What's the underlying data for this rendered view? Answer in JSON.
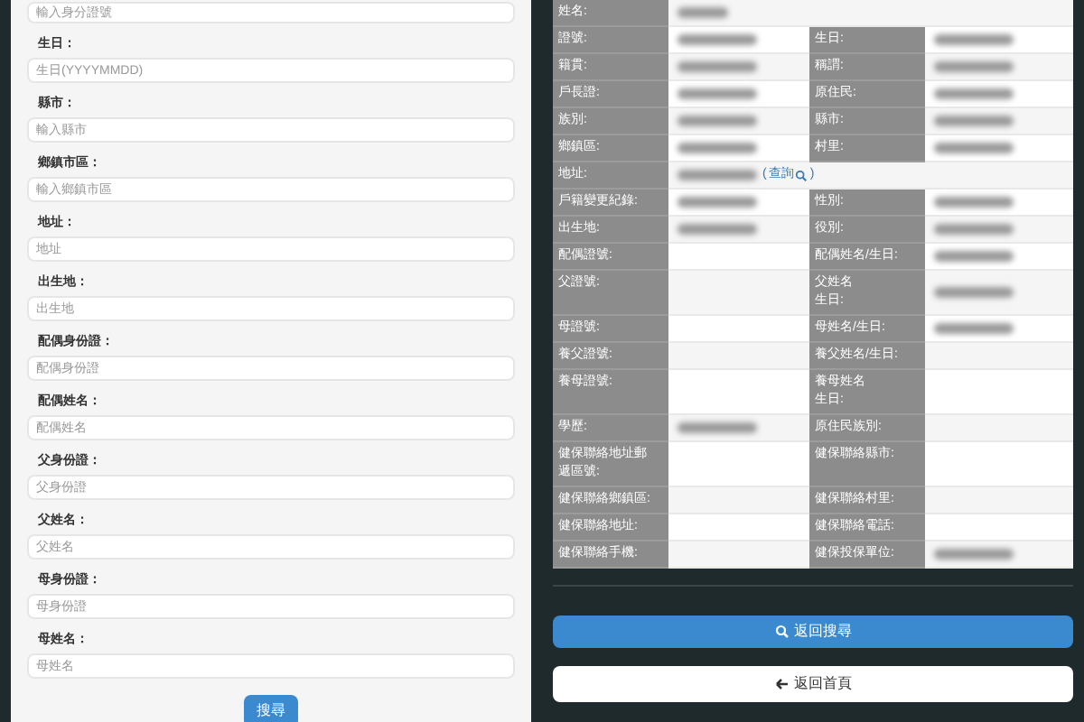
{
  "search_form": {
    "top_field": {
      "placeholder": "輸入身分證號"
    },
    "fields": [
      {
        "label": "生日：",
        "placeholder": "生日(YYYYMMDD)"
      },
      {
        "label": "縣市：",
        "placeholder": "輸入縣市"
      },
      {
        "label": "鄉鎮市區：",
        "placeholder": "輸入鄉鎮市區"
      },
      {
        "label": "地址：",
        "placeholder": "地址"
      },
      {
        "label": "出生地：",
        "placeholder": "出生地"
      },
      {
        "label": "配偶身份證：",
        "placeholder": "配偶身份證"
      },
      {
        "label": "配偶姓名：",
        "placeholder": "配偶姓名"
      },
      {
        "label": "父身份證：",
        "placeholder": "父身份證"
      },
      {
        "label": "父姓名：",
        "placeholder": "父姓名"
      },
      {
        "label": "母身份證：",
        "placeholder": "母身份證"
      },
      {
        "label": "母姓名：",
        "placeholder": "母姓名"
      }
    ],
    "submit": "搜尋"
  },
  "record": {
    "rows": [
      {
        "cells": [
          {
            "label": [
              "姓名:"
            ],
            "blurred": true
          }
        ]
      },
      {
        "cells": [
          {
            "label": [
              "證號:"
            ],
            "blurred": true
          },
          {
            "label": [
              "生日:"
            ],
            "blurred": true
          }
        ]
      },
      {
        "cells": [
          {
            "label": [
              "籍貫:"
            ],
            "blurred": true
          },
          {
            "label": [
              "稱謂:"
            ],
            "blurred": true
          }
        ]
      },
      {
        "cells": [
          {
            "label": [
              "戶長證:"
            ],
            "blurred": true
          },
          {
            "label": [
              "原住民:"
            ],
            "blurred": true
          }
        ]
      },
      {
        "cells": [
          {
            "label": [
              "族別:"
            ],
            "blurred": true
          },
          {
            "label": [
              "縣市:"
            ],
            "blurred": true
          }
        ]
      },
      {
        "cells": [
          {
            "label": [
              "鄉鎮區:"
            ],
            "blurred": true
          },
          {
            "label": [
              "村里:"
            ],
            "blurred": true
          }
        ]
      },
      {
        "cells": [
          {
            "label": [
              "地址:"
            ],
            "blurred": true,
            "note": {
              "open": "(",
              "link": "查詢",
              "close": ")"
            }
          }
        ]
      },
      {
        "cells": [
          {
            "label": [
              "戶籍變更紀錄:"
            ],
            "blurred": true
          },
          {
            "label": [
              "性別:"
            ],
            "blurred": true
          }
        ]
      },
      {
        "cells": [
          {
            "label": [
              "出生地:"
            ],
            "blurred": true
          },
          {
            "label": [
              "役別:"
            ],
            "blurred": true
          }
        ]
      },
      {
        "cells": [
          {
            "label": [
              "配偶證號:"
            ],
            "blurred": false
          },
          {
            "label": [
              "配偶姓名/生日:"
            ],
            "blurred": true
          }
        ]
      },
      {
        "cells": [
          {
            "label": [
              "父證號:"
            ],
            "blurred": false
          },
          {
            "label": [
              "父姓名",
              "生日:"
            ],
            "blurred": true
          }
        ]
      },
      {
        "cells": [
          {
            "label": [
              "母證號:"
            ],
            "blurred": false
          },
          {
            "label": [
              "母姓名/生日:"
            ],
            "blurred": true
          }
        ]
      },
      {
        "cells": [
          {
            "label": [
              "養父證號:"
            ],
            "blurred": false
          },
          {
            "label": [
              "養父姓名/生日:"
            ],
            "blurred": false
          }
        ]
      },
      {
        "cells": [
          {
            "label": [
              "養母證號:"
            ],
            "blurred": false
          },
          {
            "label": [
              "養母姓名",
              "生日:"
            ],
            "blurred": false
          }
        ]
      },
      {
        "cells": [
          {
            "label": [
              "學歷:"
            ],
            "blurred": true
          },
          {
            "label": [
              "原住民族別:"
            ],
            "blurred": false
          }
        ]
      },
      {
        "cells": [
          {
            "label": [
              "健保聯絡地址郵",
              "遞區號:"
            ],
            "blurred": false
          },
          {
            "label": [
              "健保聯絡縣市:"
            ],
            "blurred": false
          }
        ]
      },
      {
        "cells": [
          {
            "label": [
              "健保聯絡鄉鎮區:"
            ],
            "blurred": false
          },
          {
            "label": [
              "健保聯絡村里:"
            ],
            "blurred": false
          }
        ]
      },
      {
        "cells": [
          {
            "label": [
              "健保聯絡地址:"
            ],
            "blurred": false
          },
          {
            "label": [
              "健保聯絡電話:"
            ],
            "blurred": false
          }
        ]
      },
      {
        "cells": [
          {
            "label": [
              "健保聯絡手機:"
            ],
            "blurred": false
          },
          {
            "label": [
              "健保投保單位:"
            ],
            "blurred": true
          }
        ]
      }
    ]
  },
  "buttons": [
    {
      "kind": "primary",
      "label": "返回搜尋"
    },
    {
      "kind": "back",
      "label": "返回首頁"
    }
  ]
}
